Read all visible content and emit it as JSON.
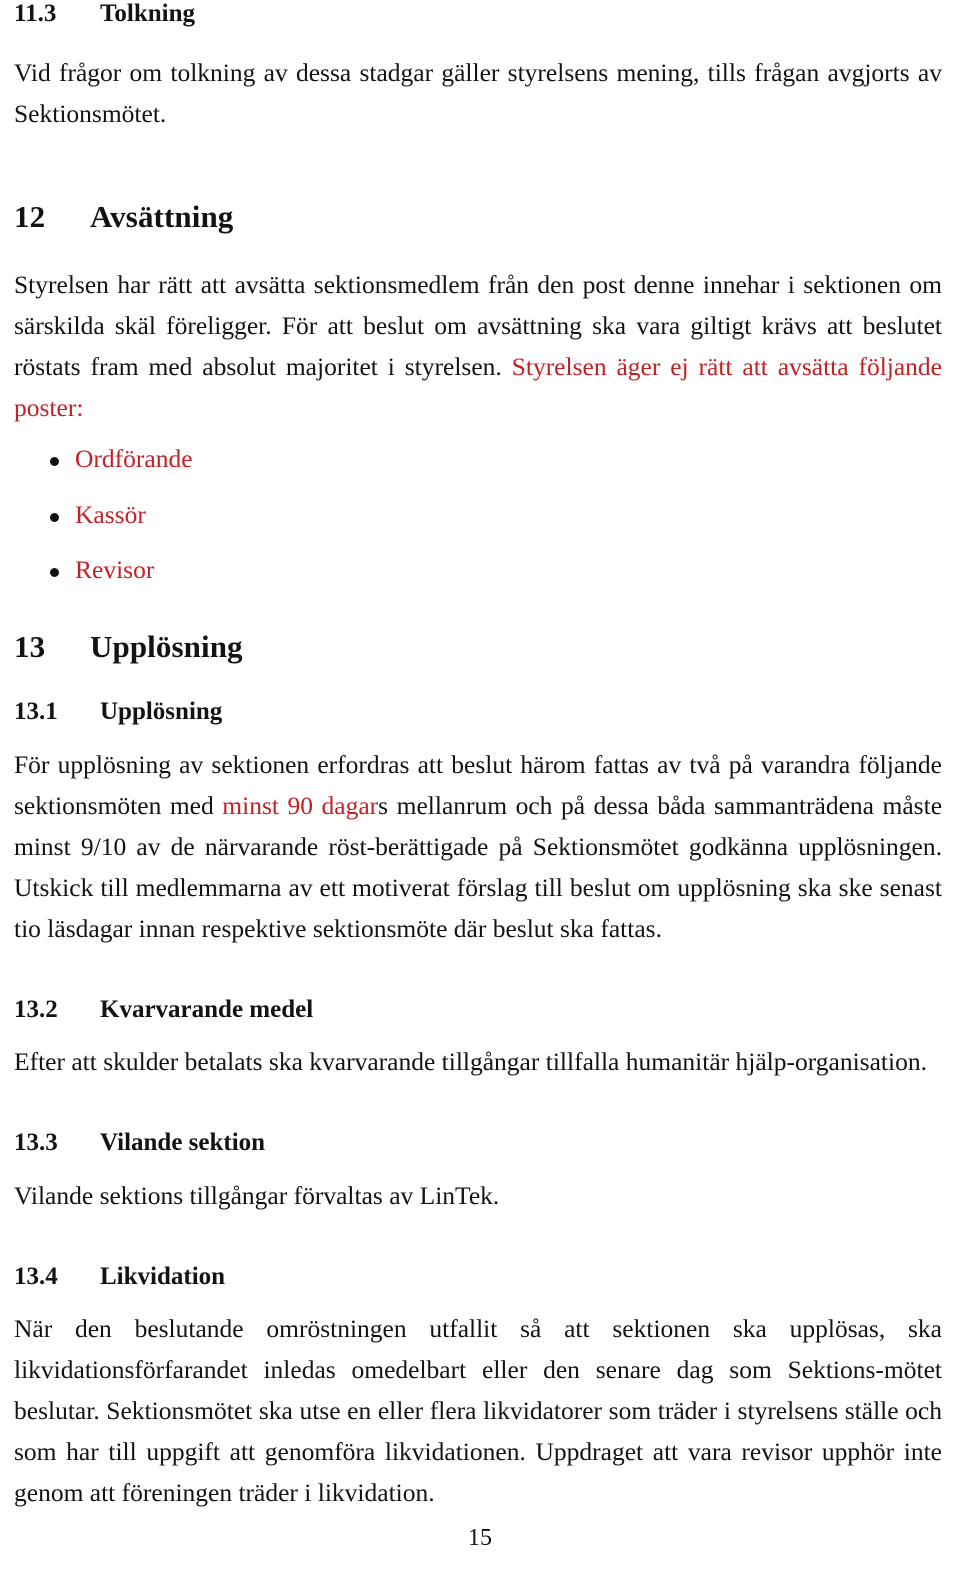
{
  "document": {
    "type": "statutes",
    "language": "sv",
    "page_number": "15",
    "accent_color": "#C32026",
    "text_color": "#131313"
  },
  "sections": {
    "s11_3": {
      "number": "11.3",
      "title": "Tolkning",
      "paragraph": "Vid frågor om tolkning av dessa stadgar gäller styrelsens mening, tills frågan avgjorts av Sektionsmötet."
    },
    "s12": {
      "number": "12",
      "title": "Avsättning",
      "paragraph_black": "Styrelsen har rätt att avsätta sektionsmedlem från den post denne innehar i sektionen om särskilda skäl föreligger. För att beslut om avsättning ska vara giltigt krävs att beslutet röstats fram med absolut majoritet i styrelsen. ",
      "paragraph_red": "Styrelsen äger ej rätt att avsätta följande poster:",
      "list_items": [
        "Ordförande",
        "Kassör",
        "Revisor"
      ]
    },
    "s13": {
      "number": "13",
      "title": "Upplösning"
    },
    "s13_1": {
      "number": "13.1",
      "title": "Upplösning",
      "paragraph_part1": "För upplösning av sektionen erfordras att beslut härom fattas av två på varandra följande sektionsmöten med ",
      "paragraph_red": "minst 90 dagar",
      "paragraph_part2": "s mellanrum och på dessa båda sammanträdena måste minst 9/10 av de närvarande röst-berättigade på Sektionsmötet godkänna upplösningen. Utskick till medlemmarna av ett motiverat förslag till beslut om upplösning ska ske senast tio läsdagar innan respektive sektionsmöte där beslut ska fattas."
    },
    "s13_2": {
      "number": "13.2",
      "title": "Kvarvarande medel",
      "paragraph": "Efter att skulder betalats ska kvarvarande tillgångar tillfalla humanitär hjälp-organisation."
    },
    "s13_3": {
      "number": "13.3",
      "title": "Vilande sektion",
      "paragraph": "Vilande sektions tillgångar förvaltas av LinTek."
    },
    "s13_4": {
      "number": "13.4",
      "title": "Likvidation",
      "paragraph": "När den beslutande omröstningen utfallit så att sektionen ska upplösas, ska likvidationsförfarandet inledas omedelbart eller den senare dag som Sektions-mötet beslutar. Sektionsmötet ska utse en eller flera likvidatorer som träder i styrelsens ställe och som har till uppgift att genomföra likvidationen. Uppdraget att vara revisor upphör inte genom att föreningen träder i likvidation."
    }
  }
}
